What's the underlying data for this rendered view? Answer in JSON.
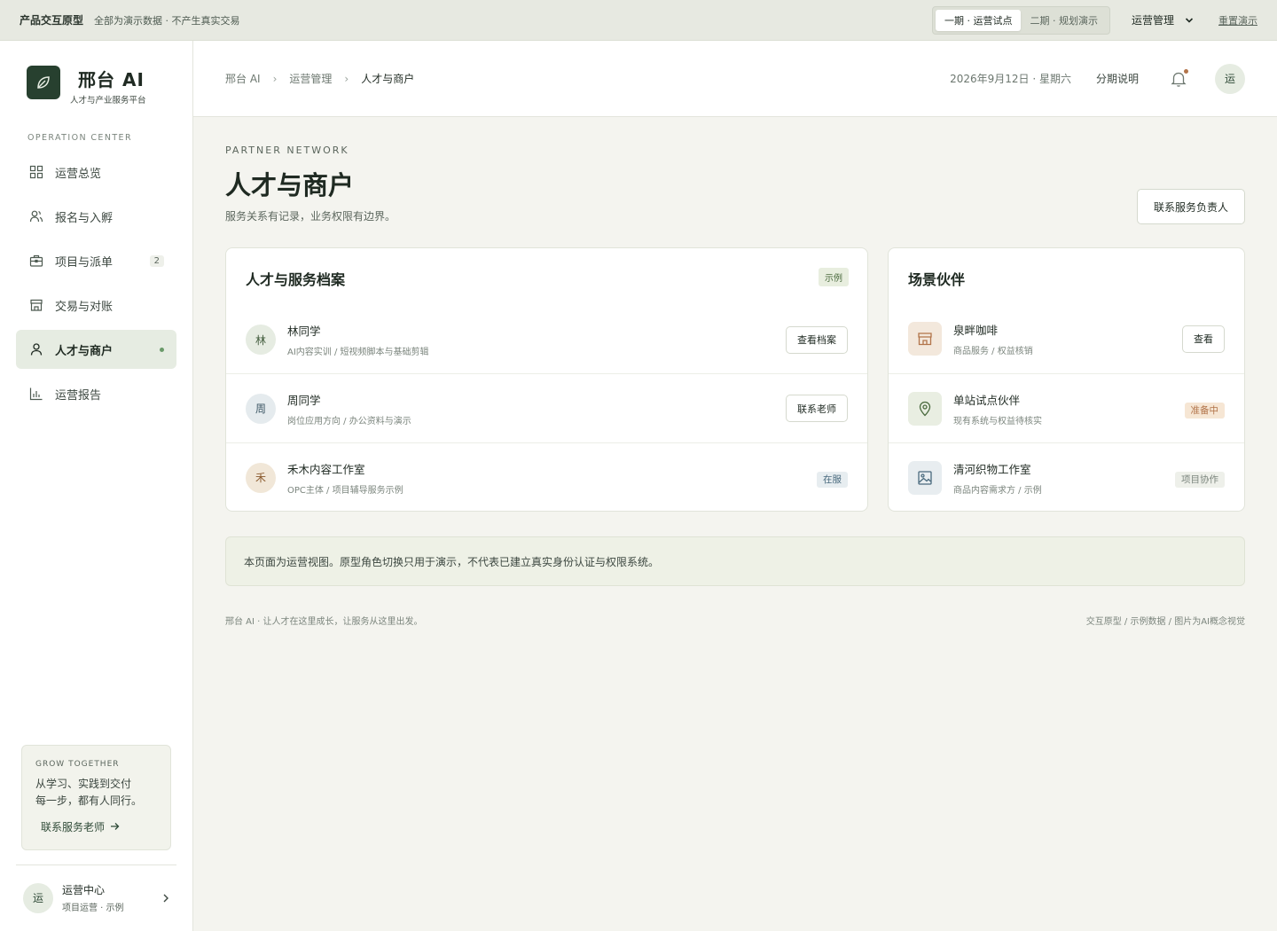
{
  "topbar": {
    "title": "产品交互原型",
    "note": "全部为演示数据 · 不产生真实交易",
    "phases": [
      "一期 · 运营试点",
      "二期 · 规划演示"
    ],
    "role": "运营管理",
    "reset": "重置演示"
  },
  "sidebar": {
    "brand_name": "邢台 AI",
    "brand_sub": "人才与产业服务平台",
    "section_label": "OPERATION CENTER",
    "items": [
      {
        "label": "运营总览",
        "icon": "grid-icon"
      },
      {
        "label": "报名与入孵",
        "icon": "users-icon"
      },
      {
        "label": "项目与派单",
        "icon": "briefcase-icon",
        "badge": "2"
      },
      {
        "label": "交易与对账",
        "icon": "store-icon"
      },
      {
        "label": "人才与商户",
        "icon": "user-icon",
        "active": true
      },
      {
        "label": "运营报告",
        "icon": "bar-chart-icon"
      }
    ],
    "grow": {
      "kicker": "GROW TOGETHER",
      "line1": "从学习、实践到交付",
      "line2": "每一步，都有人同行。",
      "link": "联系服务老师"
    },
    "user": {
      "avatar": "运",
      "name": "运营中心",
      "role": "项目运营 · 示例"
    }
  },
  "header": {
    "crumbs": [
      "邢台 AI",
      "运营管理",
      "人才与商户"
    ],
    "date": "2026年9月12日 · 星期六",
    "link": "分期说明",
    "avatar": "运"
  },
  "main": {
    "kicker": "PARTNER NETWORK",
    "title": "人才与商户",
    "subtitle": "服务关系有记录，业务权限有边界。",
    "contact_button": "联系服务负责人"
  },
  "talent_card": {
    "title": "人才与服务档案",
    "tag": "示例",
    "rows": [
      {
        "avatar": "林",
        "name": "林同学",
        "desc": "AI内容实训 / 短视频脚本与基础剪辑",
        "action": "查看档案"
      },
      {
        "avatar": "周",
        "name": "周同学",
        "desc": "岗位应用方向 / 办公资料与演示",
        "action": "联系老师"
      },
      {
        "avatar": "禾",
        "name": "禾木内容工作室",
        "desc": "OPC主体 / 项目辅导服务示例",
        "status": "在服"
      }
    ]
  },
  "partner_card": {
    "title": "场景伙伴",
    "rows": [
      {
        "icon": "store-icon",
        "name": "泉畔咖啡",
        "desc": "商品服务 / 权益核销",
        "action": "查看"
      },
      {
        "icon": "location-pin-icon",
        "name": "单站试点伙伴",
        "desc": "现有系统与权益待核实",
        "status": "准备中"
      },
      {
        "icon": "image-icon",
        "name": "清河织物工作室",
        "desc": "商品内容需求方 / 示例",
        "status": "项目协作"
      }
    ]
  },
  "notice": "本页面为运营视图。原型角色切换只用于演示，不代表已建立真实身份认证与权限系统。",
  "footer": {
    "left": "邢台 AI · 让人才在这里成长，让服务从这里出发。",
    "right": "交互原型 / 示例数据 / 图片为AI概念视觉"
  },
  "colors": {
    "brand": "#27402f",
    "accent_bg": "#e6ece2",
    "status_active": "#4a6a7e",
    "status_pending": "#b2744a"
  }
}
